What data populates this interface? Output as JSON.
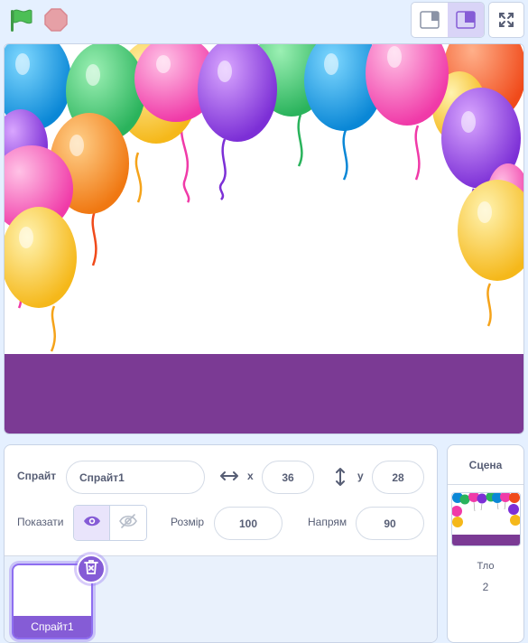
{
  "controls": {
    "green_flag_icon": "green-flag-icon",
    "stop_icon": "stop-icon",
    "small_stage_icon": "small-stage-icon",
    "large_stage_icon": "large-stage-icon",
    "fullscreen_icon": "fullscreen-icon"
  },
  "colors": {
    "accent": "#855cd6",
    "stage_floor": "#7b3a94",
    "green_flag": "#4cbf56",
    "stop": "#e6a0a6"
  },
  "sprite_info": {
    "sprite_label": "Спрайт",
    "sprite_name": "Спрайт1",
    "x_label": "x",
    "x_value": "36",
    "y_label": "y",
    "y_value": "28",
    "show_label": "Показати",
    "size_label": "Розмір",
    "size_value": "100",
    "direction_label": "Напрям",
    "direction_value": "90"
  },
  "sprites": [
    {
      "name": "Спрайт1",
      "selected": true
    }
  ],
  "stage_panel": {
    "title": "Сцена",
    "backdrops_label": "Тло",
    "backdrops_count": "2"
  }
}
